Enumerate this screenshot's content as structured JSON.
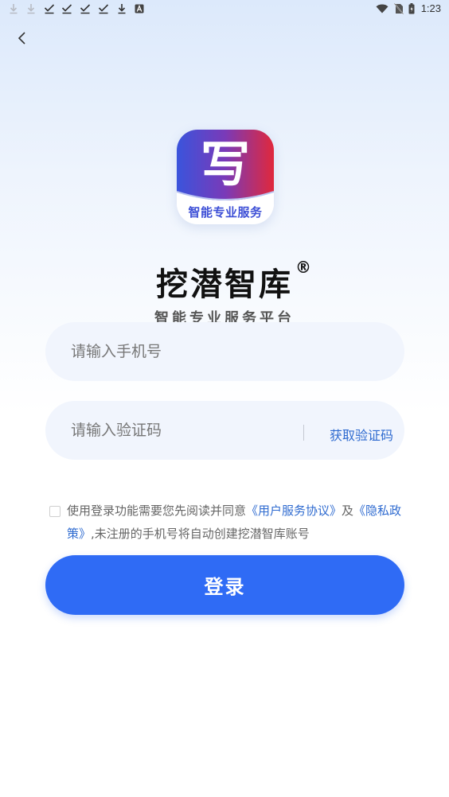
{
  "status_bar": {
    "time": "1:23",
    "notification_icons": [
      "download-icon",
      "download-icon",
      "check-icon",
      "check-icon",
      "check-icon",
      "check-icon",
      "download-icon",
      "font-icon"
    ],
    "right_icons": [
      "wifi-icon",
      "no-sim-icon",
      "battery-icon"
    ]
  },
  "back_icon": "back-arrow-icon",
  "logo": {
    "glyph": "写",
    "subtitle": "智能专业服务"
  },
  "app": {
    "name": "挖潜智库",
    "registered_mark": "®",
    "slogan": "智能专业服务平台"
  },
  "form": {
    "phone_placeholder": "请输入手机号",
    "code_placeholder": "请输入验证码",
    "get_code_label": "获取验证码"
  },
  "agreement": {
    "text_prefix": "使用登录功能需要您先阅读并同意",
    "user_agreement_link": "《用户服务协议》",
    "and_text": "及",
    "privacy_link": "《隐私政策》",
    "text_suffix": ",未注册的手机号将自动创建挖潜智库账号"
  },
  "login_button": "登录",
  "colors": {
    "primary": "#2f6bf5",
    "link": "#2f6bd0",
    "input_bg": "#f1f5fd"
  }
}
